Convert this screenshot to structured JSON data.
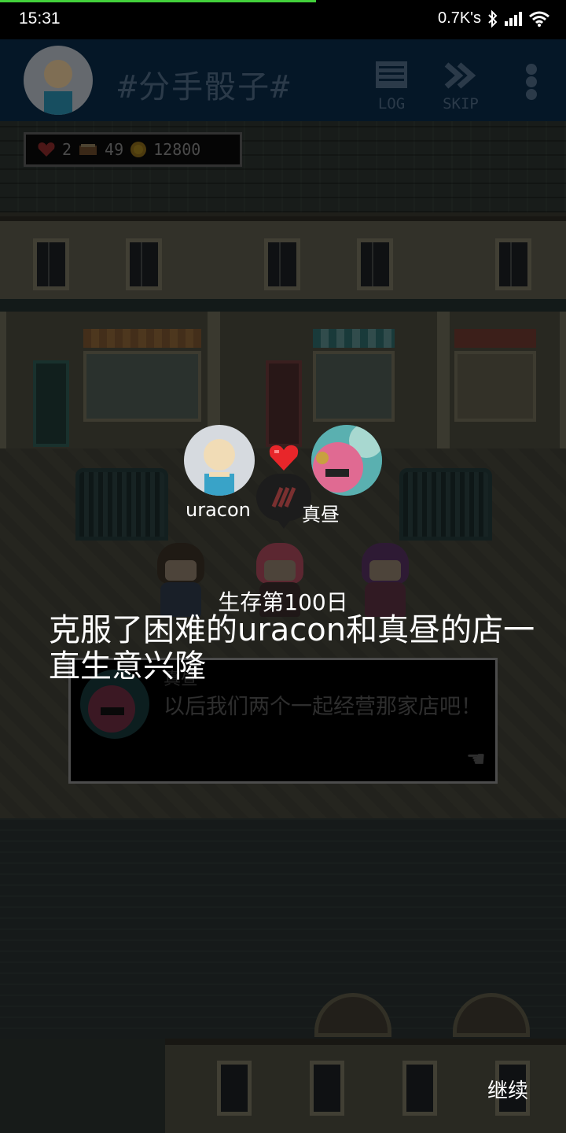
{
  "status_bar": {
    "time": "15:31",
    "network_speed": "0.7K's",
    "icons": [
      "bluetooth-icon",
      "signal-icon",
      "wifi-icon"
    ]
  },
  "top_bar": {
    "title": "#分手骰子#",
    "log_label": "LOG",
    "skip_label": "SKIP",
    "menu_icon": "vertical-dots-icon"
  },
  "resources": {
    "hearts": "2",
    "books": "49",
    "coins": "12800"
  },
  "couple": {
    "player_name": "uracon",
    "partner_name": "真昼",
    "heart_icon": "heart-icon"
  },
  "dialog": {
    "speaker": "真昼",
    "text": "以后我们两个一起经营那家店吧！"
  },
  "ending": {
    "day_text": "生存第100日",
    "result_text": "克服了困难的uracon和真昼的店一直生意兴隆"
  },
  "continue_label": "继续",
  "colors": {
    "top_bar_bg": "#0a2a47",
    "heart_red": "#e8262a",
    "progress_green": "#43d13b"
  }
}
